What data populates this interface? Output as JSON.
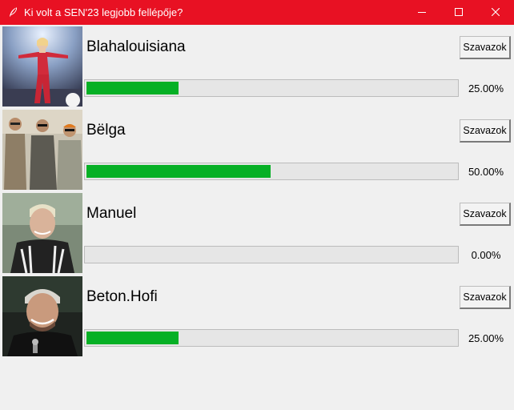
{
  "window": {
    "title": "Ki volt a SEN'23 legjobb fellépője?",
    "icon": "feather-icon",
    "accent_color": "#e81123",
    "controls": [
      "minimize-icon",
      "maximize-icon",
      "close-icon"
    ]
  },
  "progress_color": "#06b025",
  "candidates": [
    {
      "name": "Blahalouisiana",
      "button_label": "Szavazok",
      "percent_label": "25.00%",
      "share": 0.25
    },
    {
      "name": "Bëlga",
      "button_label": "Szavazok",
      "percent_label": "50.00%",
      "share": 0.5
    },
    {
      "name": "Manuel",
      "button_label": "Szavazok",
      "percent_label": "0.00%",
      "share": 0.0
    },
    {
      "name": "Beton.Hofi",
      "button_label": "Szavazok",
      "percent_label": "25.00%",
      "share": 0.25
    }
  ]
}
